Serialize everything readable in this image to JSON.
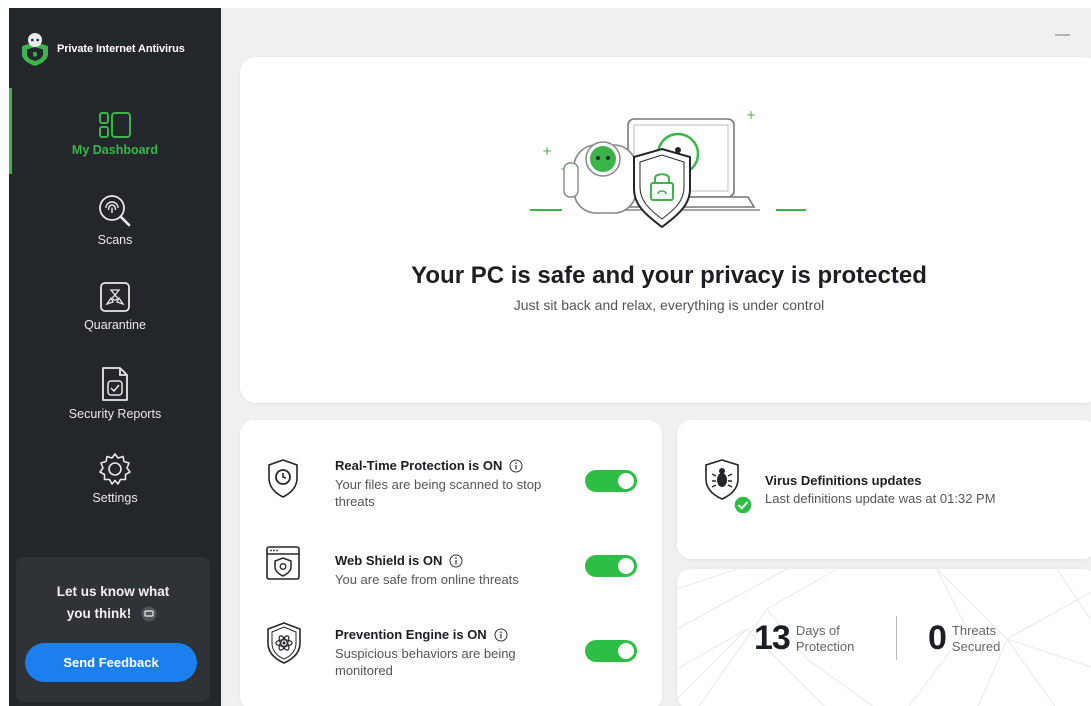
{
  "app": {
    "name": "Private Internet Antivirus",
    "minimize_glyph": "—"
  },
  "sidebar": {
    "items": [
      {
        "label": "My Dashboard",
        "icon": "dashboard-icon",
        "active": true
      },
      {
        "label": "Scans",
        "icon": "fingerprint-scan-icon",
        "active": false
      },
      {
        "label": "Quarantine",
        "icon": "biohazard-box-icon",
        "active": false
      },
      {
        "label": "Security Reports",
        "icon": "report-document-icon",
        "active": false
      },
      {
        "label": "Settings",
        "icon": "gear-icon",
        "active": false
      }
    ],
    "feedback": {
      "title_line1": "Let us know what",
      "title_line2": "you think!",
      "button": "Send Feedback"
    }
  },
  "hero": {
    "title": "Your PC is safe and your privacy is protected",
    "subtitle": "Just sit back and relax, everything is under control"
  },
  "protections": [
    {
      "title": "Real-Time Protection is ON",
      "desc": "Your files are being scanned to stop threats",
      "icon": "clock-shield-icon",
      "enabled": true
    },
    {
      "title": "Web Shield is ON",
      "desc": "You are safe from online threats",
      "icon": "browser-shield-icon",
      "enabled": true
    },
    {
      "title": "Prevention Engine is ON",
      "desc": "Suspicious behaviors are being monitored",
      "icon": "atom-shield-icon",
      "enabled": true
    }
  ],
  "definitions": {
    "title": "Virus Definitions updates",
    "subtitle": "Last definitions update was at 01:32 PM"
  },
  "stats": {
    "days": {
      "value": "13",
      "line1": "Days of",
      "line2": "Protection"
    },
    "threats": {
      "value": "0",
      "line1": "Threats",
      "line2": "Secured"
    }
  },
  "colors": {
    "accent_green": "#3bb54a",
    "toggle_green": "#2ebe45",
    "button_blue": "#1b7ff0",
    "sidebar_bg": "#23262b"
  }
}
